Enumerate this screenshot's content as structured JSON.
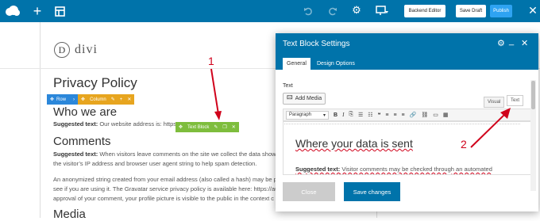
{
  "toolbar": {
    "backend_editor": "Backend Editor",
    "save_draft": "Save Draft",
    "publish": "Publish"
  },
  "page": {
    "logo": "divi",
    "h1": "Privacy Policy",
    "who_heading": "Who we are",
    "suggested_label": "Suggested text:",
    "who_text": " Our website address is: https:",
    "comments_heading": "Comments",
    "comments_text": " When visitors leave comments on the site we collect the data shown",
    "comments_line2": "the visitor’s IP address and browser user agent string to help spam detection.",
    "anon_line1": "An anonymized string created from your email address (also called a hash) may be p",
    "anon_line2": "see if you are using it. The Gravatar service privacy policy is available here: https://au",
    "anon_line3": "approval of your comment, your profile picture is visible to the public in the context c",
    "media_heading": "Media"
  },
  "builder": {
    "row_label": "Row",
    "column_label": "Column",
    "module_label": "Text Block"
  },
  "modal": {
    "title": "Text Block Settings",
    "tabs": [
      "General",
      "Design Options"
    ],
    "field_label": "Text",
    "add_media": "Add Media",
    "editor_tabs": [
      "Visual",
      "Text"
    ],
    "format_select": "Paragraph",
    "editor_heading": "Where your data is sent",
    "editor_suggested": "Suggested text:",
    "editor_text": " Visitor comments may be checked through an automated",
    "close_label": "Close",
    "save_label": "Save changes"
  },
  "annotations": {
    "one": "1",
    "two": "2"
  },
  "colors": {
    "topbar": "#0073aa",
    "row_bar": "#2b87da",
    "column_bar": "#e7a51f",
    "module_bar": "#7ebd3d",
    "annotation": "#d0021b"
  }
}
